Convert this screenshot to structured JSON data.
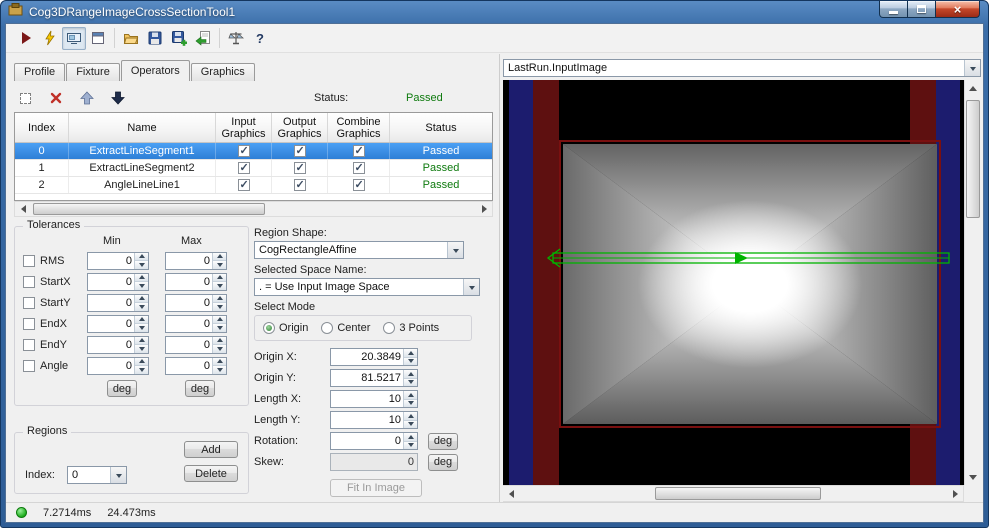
{
  "window": {
    "title": "Cog3DRangeImageCrossSectionTool1"
  },
  "icons": {
    "help_glyph": "?",
    "close_glyph": "×"
  },
  "toolbar": {
    "icons": [
      "run",
      "electric-run",
      "result-display",
      "float-window",
      "open-file",
      "save",
      "save-results",
      "import-results",
      "calibration",
      "help"
    ],
    "result_display_pressed": true
  },
  "tabs": {
    "items": [
      {
        "label": "Profile",
        "active": false
      },
      {
        "label": "Fixture",
        "active": false
      },
      {
        "label": "Operators",
        "active": true
      },
      {
        "label": "Graphics",
        "active": false
      }
    ]
  },
  "operators": {
    "toolbar": {
      "status_label": "Status:",
      "status_value": "Passed"
    },
    "table": {
      "columns": [
        "Index",
        "Name",
        "Input Graphics",
        "Output Graphics",
        "Combine Graphics",
        "Status"
      ],
      "rows": [
        {
          "index": "0",
          "name": "ExtractLineSegment1",
          "input_graphics": true,
          "output_graphics": true,
          "combine_graphics": true,
          "status": "Passed",
          "selected": true
        },
        {
          "index": "1",
          "name": "ExtractLineSegment2",
          "input_graphics": true,
          "output_graphics": true,
          "combine_graphics": true,
          "status": "Passed",
          "selected": false
        },
        {
          "index": "2",
          "name": "AngleLineLine1",
          "input_graphics": true,
          "output_graphics": true,
          "combine_graphics": true,
          "status": "Passed",
          "selected": false
        }
      ]
    }
  },
  "tolerances": {
    "title": "Tolerances",
    "min_header": "Min",
    "max_header": "Max",
    "deg_label": "deg",
    "rows": [
      {
        "label": "RMS",
        "checked": false,
        "min": "0",
        "max": "0"
      },
      {
        "label": "StartX",
        "checked": false,
        "min": "0",
        "max": "0"
      },
      {
        "label": "StartY",
        "checked": false,
        "min": "0",
        "max": "0"
      },
      {
        "label": "EndX",
        "checked": false,
        "min": "0",
        "max": "0"
      },
      {
        "label": "EndY",
        "checked": false,
        "min": "0",
        "max": "0"
      },
      {
        "label": "Angle",
        "checked": false,
        "min": "0",
        "max": "0"
      }
    ]
  },
  "region": {
    "shape_label": "Region Shape:",
    "shape_value": "CogRectangleAffine",
    "space_label": "Selected Space Name:",
    "space_value": ". = Use Input Image Space",
    "select_mode": {
      "title": "Select Mode",
      "options": [
        {
          "label": "Origin",
          "selected": true
        },
        {
          "label": "Center",
          "selected": false
        },
        {
          "label": "3 Points",
          "selected": false
        }
      ]
    },
    "fields": [
      {
        "label": "Origin X:",
        "value": "20.3849"
      },
      {
        "label": "Origin Y:",
        "value": "81.5217"
      },
      {
        "label": "Length X:",
        "value": "10"
      },
      {
        "label": "Length Y:",
        "value": "10"
      },
      {
        "label": "Rotation:",
        "value": "0"
      },
      {
        "label": "Skew:",
        "value": "0"
      }
    ],
    "deg_label": "deg",
    "fit_button": "Fit In Image"
  },
  "regions_group": {
    "title": "Regions",
    "add_button": "Add",
    "index_label": "Index:",
    "index_value": "0",
    "delete_button": "Delete"
  },
  "display": {
    "source": "LastRun.InputImage"
  },
  "image_colors": {
    "background": "#000000",
    "stripe_blue": "#1c1c6e",
    "stripe_red": "#5e1010",
    "region_outline": "#00b400",
    "rect_outline": "#7a1010"
  },
  "statusbar": {
    "time1": "7.2714ms",
    "time2": "24.473ms"
  }
}
